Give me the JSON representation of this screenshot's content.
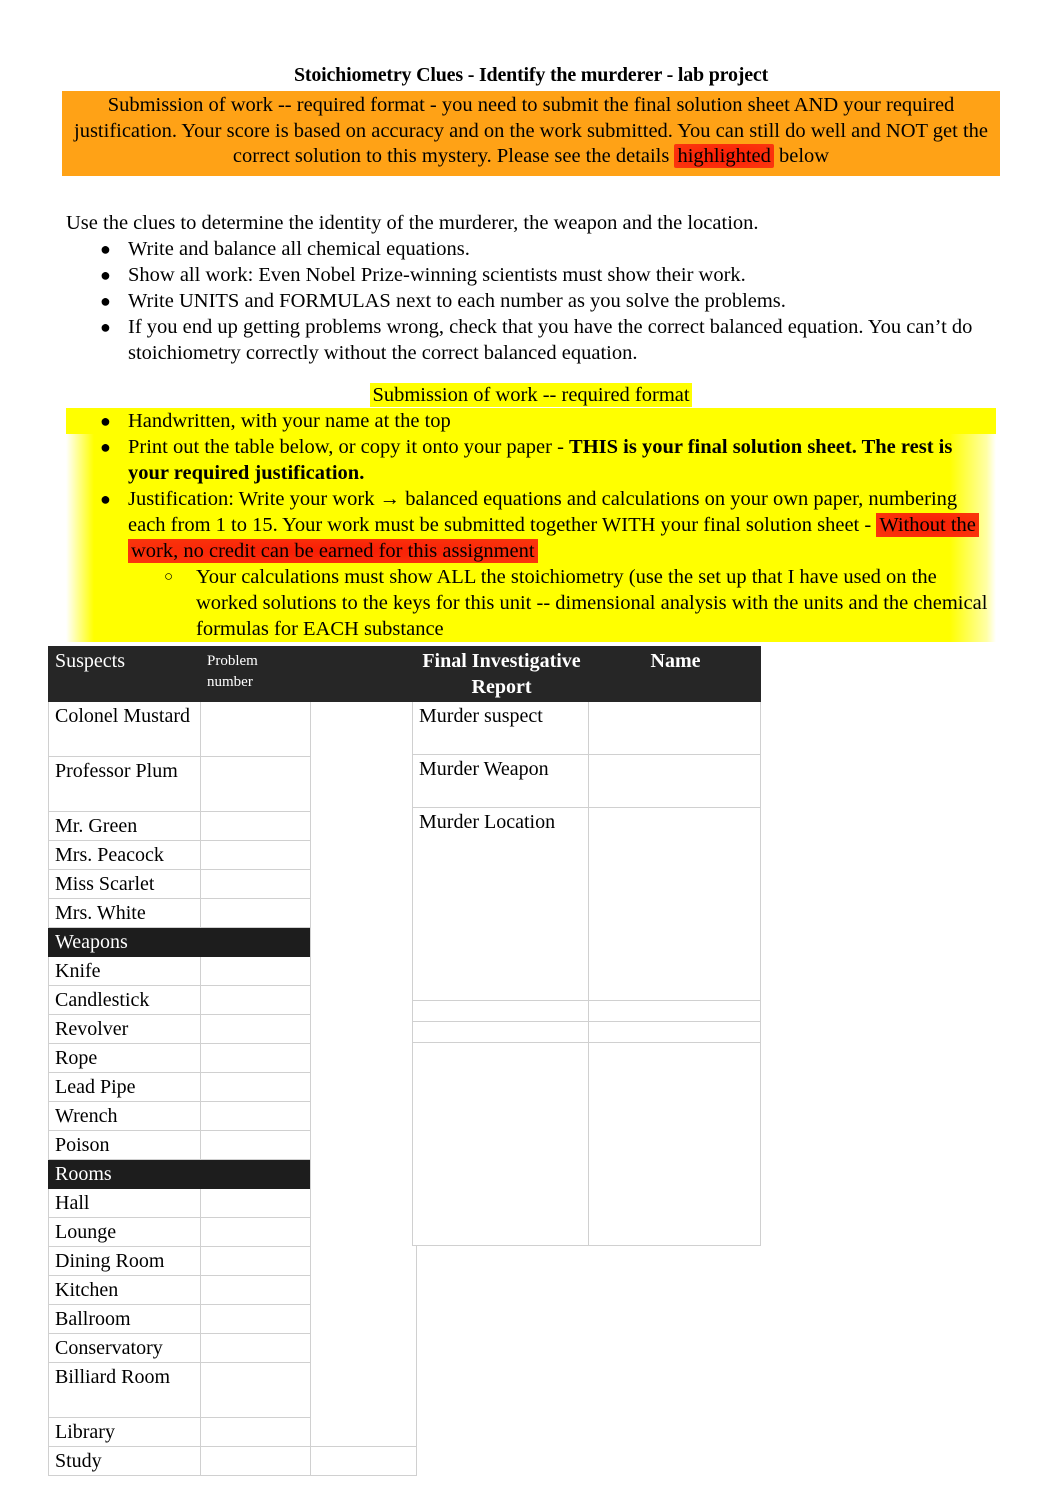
{
  "document": {
    "title": "Stoichiometry Clues - Identify the murderer - lab project",
    "banner": {
      "part1": "Submission of work -- required format - you need to submit the final solution sheet AND your required justification. Your score is based on accuracy and on the work submitted. You can still do well and NOT get the correct solution to this mystery. Please see the details ",
      "highlight_word": "highlighted",
      "part2": " below",
      "background_color": "#FFA216",
      "highlight_color": "#FB1D05"
    },
    "intro": "Use the clues to determine the identity of the murderer, the weapon and the location.",
    "instructions": [
      "Write and balance all chemical equations.",
      "Show all work: Even Nobel Prize-winning scientists must show their work.",
      "Write UNITS and FORMULAS next to each number as you solve the problems.",
      "If you end up getting problems wrong, check that you have the correct balanced equation. You can’t do stoichiometry correctly without the correct balanced equation."
    ],
    "submission": {
      "heading": "Submission of work -- required format",
      "highlight_color": "#FFFF00",
      "bullet1": "Handwritten, with your name at the top",
      "bullet2_plain": "Print out the table below, or copy it onto your paper - ",
      "bullet2_bold": "THIS is your final solution sheet. The rest is your required justification.",
      "bullet3_plain": "Justification: Write your work → balanced equations and calculations on your own paper, numbering each from 1 to 15. Your work must be submitted together WITH your final solution sheet - ",
      "bullet3_red": "Without the work, no credit can be earned for this assignment",
      "red_color": "#FB1D05",
      "subbullet": "Your calculations must show ALL the stoichiometry (use the set up that I have used on the worked solutions to the keys for this unit -- dimensional analysis with the units and the chemical formulas for EACH substance"
    }
  },
  "suspects_table": {
    "header": {
      "col1": "Suspects",
      "col2": "Problem number",
      "col3": ""
    },
    "sections": [
      {
        "label": "Suspects",
        "items": [
          "Colonel Mustard",
          "Professor Plum",
          "Mr. Green",
          "Mrs. Peacock",
          "Miss Scarlet",
          "Mrs. White"
        ]
      },
      {
        "label": "Weapons",
        "items": [
          "Knife",
          "Candlestick",
          "Revolver",
          "Rope",
          "Lead Pipe",
          "Wrench",
          "Poison"
        ]
      },
      {
        "label": "Rooms",
        "items": [
          "Hall",
          "Lounge",
          "Dining Room",
          "Kitchen",
          "Ballroom",
          "Conservatory",
          "Billiard Room",
          "Library",
          "Study"
        ]
      }
    ]
  },
  "report_table": {
    "header": {
      "col1": "Final Investigative Report",
      "col2": "Name"
    },
    "rows": [
      {
        "label": "Murder suspect",
        "value": ""
      },
      {
        "label": "Murder Weapon",
        "value": ""
      },
      {
        "label": "Murder Location",
        "value": ""
      },
      {
        "label": "",
        "value": ""
      },
      {
        "label": "",
        "value": ""
      },
      {
        "label": "",
        "value": ""
      }
    ]
  }
}
